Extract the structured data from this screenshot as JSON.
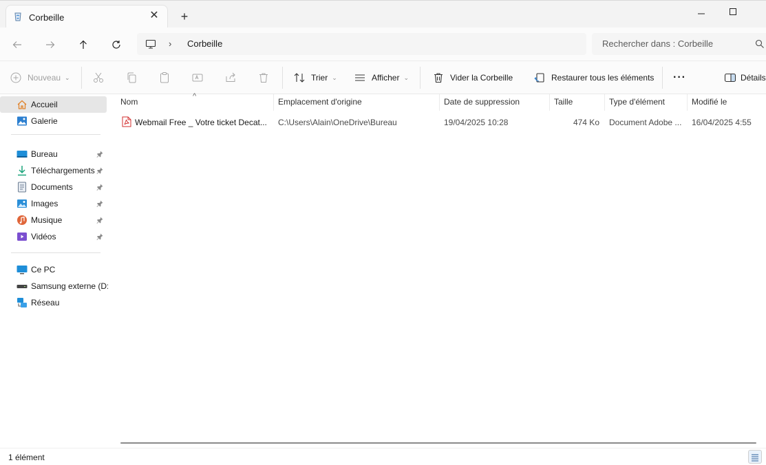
{
  "tab": {
    "title": "Corbeille",
    "close_label": "✕",
    "new_tab_label": "+"
  },
  "address": {
    "separator": "›",
    "crumb": "Corbeille"
  },
  "search": {
    "placeholder": "Rechercher dans : Corbeille"
  },
  "commands": {
    "nouveau": "Nouveau",
    "trier": "Trier",
    "afficher": "Afficher",
    "vider": "Vider la Corbeille",
    "restaurer": "Restaurer tous les éléments",
    "plus": "···",
    "details": "Détails"
  },
  "sidebar": {
    "quick": [
      {
        "label": "Accueil",
        "icon": "home-icon",
        "selected": true
      },
      {
        "label": "Galerie",
        "icon": "gallery-icon"
      }
    ],
    "pinned": [
      {
        "label": "Bureau",
        "icon": "desktop-icon"
      },
      {
        "label": "Téléchargements",
        "icon": "downloads-icon"
      },
      {
        "label": "Documents",
        "icon": "documents-icon"
      },
      {
        "label": "Images",
        "icon": "images-icon"
      },
      {
        "label": "Musique",
        "icon": "music-icon"
      },
      {
        "label": "Vidéos",
        "icon": "videos-icon"
      }
    ],
    "devices": [
      {
        "label": "Ce PC",
        "icon": "pc-icon"
      },
      {
        "label": "Samsung externe (D:",
        "icon": "drive-icon"
      },
      {
        "label": "Réseau",
        "icon": "network-icon"
      }
    ]
  },
  "columns": {
    "nom": "Nom",
    "emplacement": "Emplacement d'origine",
    "date": "Date de suppression",
    "taille": "Taille",
    "type": "Type d'élément",
    "modifie": "Modifié le"
  },
  "rows": [
    {
      "nom": "Webmail Free _ Votre ticket Decat...",
      "emplacement": "C:\\Users\\Alain\\OneDrive\\Bureau",
      "date": "19/04/2025 10:28",
      "taille": "474 Ko",
      "type": "Document Adobe ...",
      "modifie": "16/04/2025 4:55"
    }
  ],
  "status": {
    "count": "1 élément"
  },
  "colors": {
    "accent": "#0067c0",
    "selected_bg": "#e6e6e6",
    "pdf_red": "#d32f2f"
  }
}
